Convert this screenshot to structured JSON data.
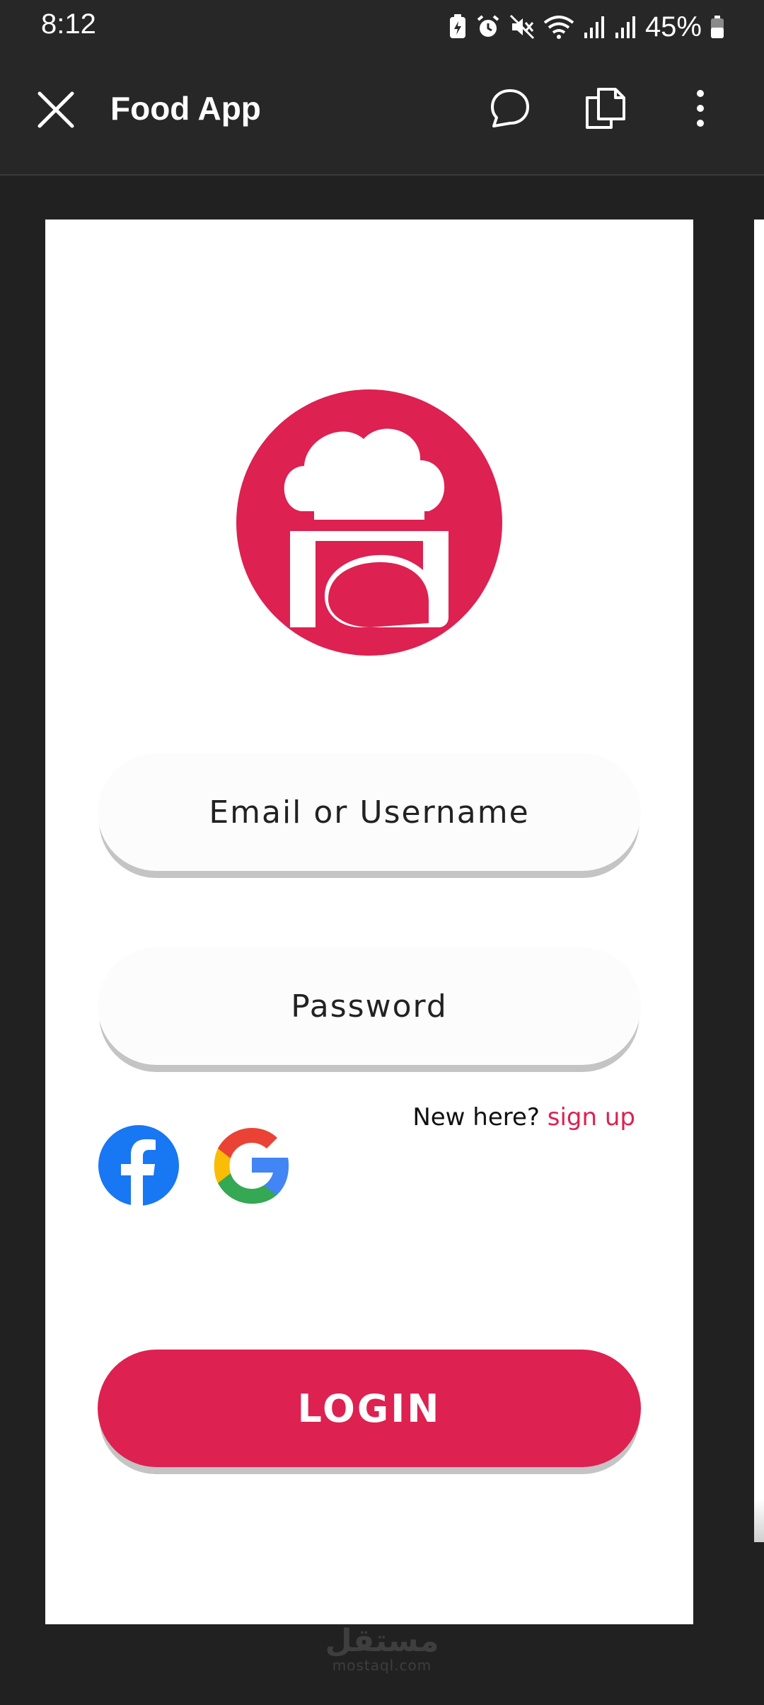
{
  "status_bar": {
    "time": "8:12",
    "battery_percent": "45%",
    "icons": [
      "battery-saver-icon",
      "alarm-icon",
      "mute-icon",
      "wifi-icon",
      "signal-icon",
      "signal-icon",
      "battery-icon"
    ]
  },
  "app_bar": {
    "title": "Food App",
    "icons": [
      "close-icon",
      "comment-icon",
      "copy-icon",
      "more-vert-icon"
    ]
  },
  "login_screen": {
    "logo_icon": "chef-hat-icon",
    "email_placeholder": "Email or Username",
    "password_placeholder": "Password",
    "signup_prompt": "New here?",
    "signup_link": "sign up",
    "login_label": "LOGIN",
    "social_icons": [
      "facebook-icon",
      "google-icon"
    ]
  },
  "watermark": {
    "arabic": "مستقل",
    "latin": "mostaql.com"
  },
  "colors": {
    "accent": "#dd2151",
    "chrome": "#272727",
    "background": "#212121"
  }
}
